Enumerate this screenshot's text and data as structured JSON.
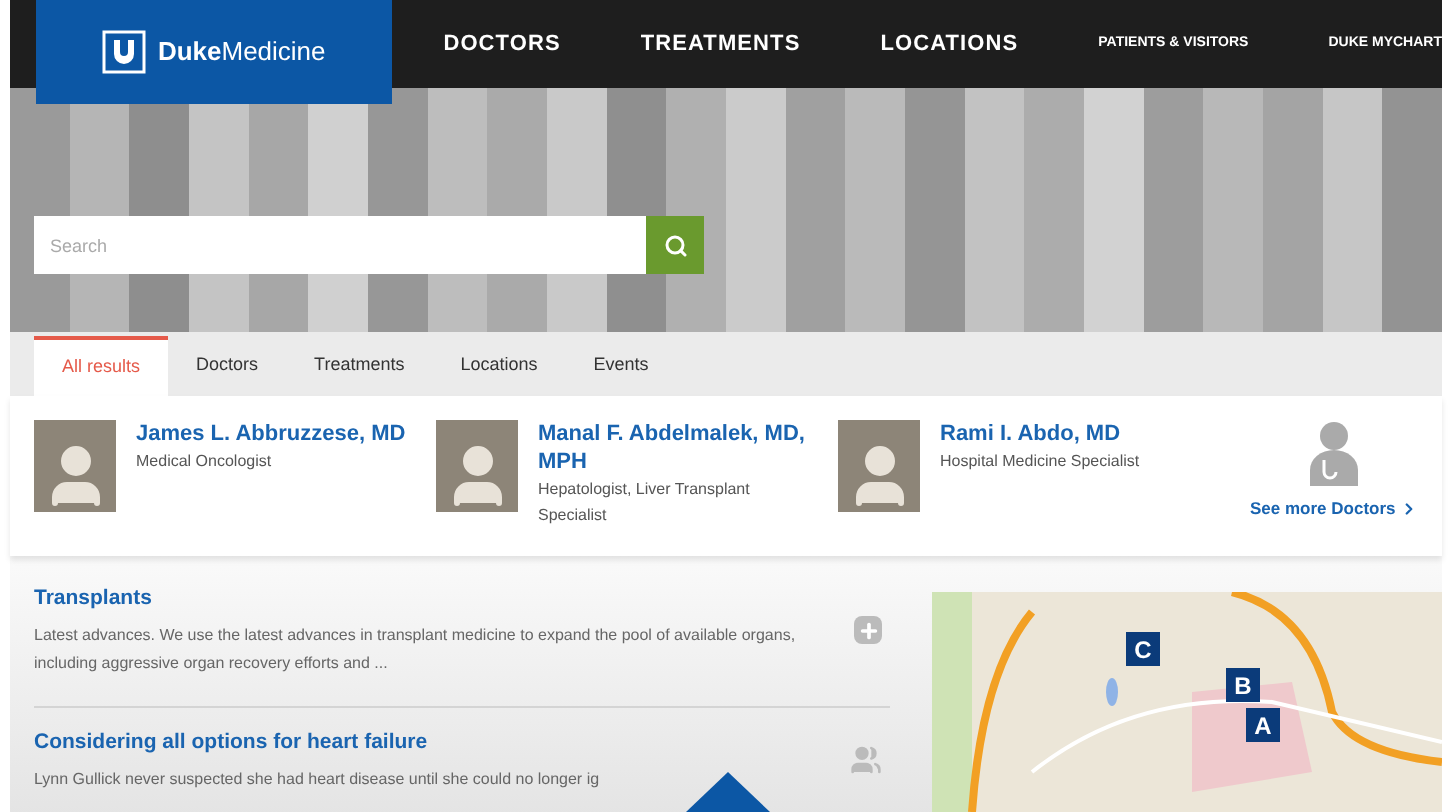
{
  "logo": {
    "bold": "Duke",
    "light": "Medicine"
  },
  "nav": [
    {
      "label": "DOCTORS",
      "kind": "large"
    },
    {
      "label": "TREATMENTS",
      "kind": "large"
    },
    {
      "label": "LOCATIONS",
      "kind": "large"
    },
    {
      "label": "PATIENTS & VISITORS",
      "kind": "small"
    },
    {
      "label": "DUKE MYCHART",
      "kind": "small"
    }
  ],
  "search": {
    "placeholder": "Search"
  },
  "tabs": [
    {
      "label": "All results",
      "selected": true
    },
    {
      "label": "Doctors",
      "selected": false
    },
    {
      "label": "Treatments",
      "selected": false
    },
    {
      "label": "Locations",
      "selected": false
    },
    {
      "label": "Events",
      "selected": false
    }
  ],
  "doctors": [
    {
      "name": "James L. Abbruzzese, MD",
      "specialty": "Medical Oncologist"
    },
    {
      "name": "Manal F. Abdelmalek, MD, MPH",
      "specialty": "Hepatologist, Liver Transplant Specialist"
    },
    {
      "name": "Rami I. Abdo, MD",
      "specialty": "Hospital Medicine Specialist"
    }
  ],
  "see_more": "See more Doctors",
  "results": [
    {
      "title": "Transplants",
      "text": "Latest advances. We use the latest advances in transplant medicine to expand the pool of available organs, including aggressive organ recovery efforts and ...",
      "kind": "plus"
    },
    {
      "title": "Considering all options for heart failure",
      "text": "Lynn Gullick never suspected she had heart disease until she could no longer ig",
      "kind": "people"
    }
  ],
  "map": {
    "pins": [
      "C",
      "B",
      "A"
    ]
  }
}
